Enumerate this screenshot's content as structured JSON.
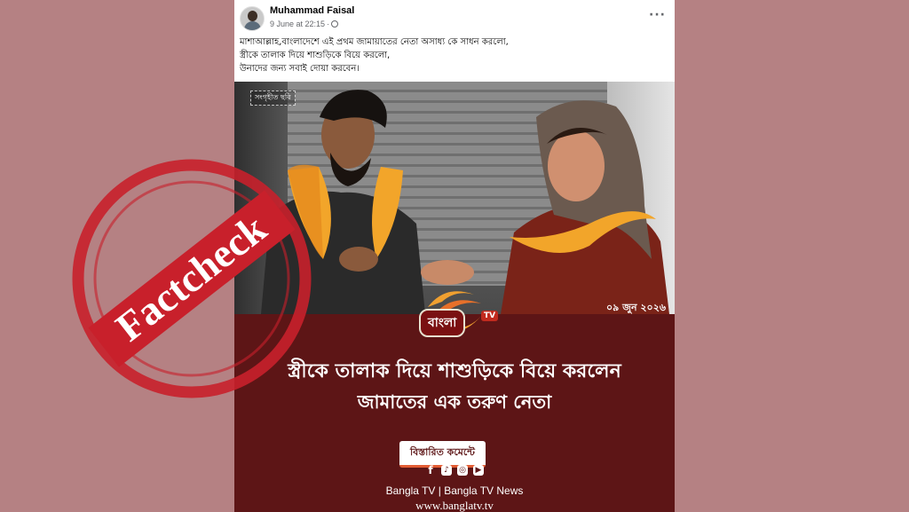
{
  "post": {
    "author": "Muhammad Faisal",
    "timestamp": "9 June at 22:15",
    "caption_lines": [
      "মাশাআল্লাহ,বাংলাদেশে এই প্রথম জামায়াতের নেতা অসাধ্য কে সাধন করলো,",
      "স্ত্রীকে তালাক দিয়ে শাশুড়িকে বিয়ে করলো,",
      "উনাদের জন্য সবাই দোয়া করবেন।"
    ],
    "icons": {
      "more": "more-horizontal-icon",
      "privacy": "globe-icon"
    }
  },
  "media": {
    "photo_credit": "সংগৃহীত ছবি",
    "date_stamp": "০৯ জুন ২০২৬",
    "logo_text": "বাংলা",
    "logo_tv": "TV",
    "headline_line1": "স্ত্রীকে তালাক দিয়ে শাশুড়িকে বিয়ে করলেন",
    "headline_line2": "জামাতের এক তরুণ নেতা",
    "cta": "বিস্তারিত কমেন্টে",
    "footer": "Bangla TV | Bangla TV News",
    "url": "www.banglatv.tv",
    "social_icons": [
      "facebook-icon",
      "tiktok-icon",
      "instagram-icon",
      "youtube-icon"
    ]
  },
  "stamp": {
    "text": "Factcheck",
    "color": "#c8202b"
  },
  "colors": {
    "background": "#b58183",
    "media_bg": "#5d1516"
  }
}
